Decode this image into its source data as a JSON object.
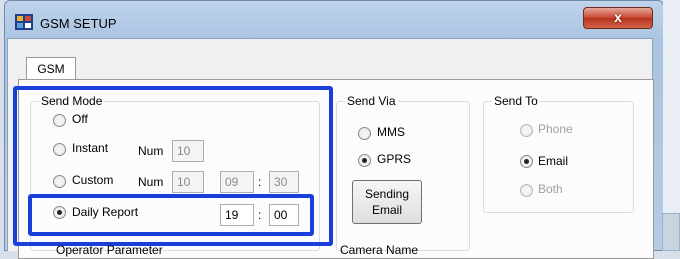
{
  "window": {
    "title": "GSM SETUP",
    "close_symbol": "x"
  },
  "tabs": [
    {
      "label": "GSM"
    }
  ],
  "send_mode": {
    "label": "Send Mode",
    "options": [
      {
        "label": "Off",
        "selected": false
      },
      {
        "label": "Instant",
        "selected": false
      },
      {
        "label": "Custom",
        "selected": false
      },
      {
        "label": "Daily Report",
        "selected": true
      }
    ],
    "instant_num_label": "Num",
    "instant_num_value": "10",
    "custom_num_label": "Num",
    "custom_num_value": "10",
    "custom_hour": "09",
    "custom_minute": "30",
    "daily_hour": "19",
    "daily_minute": "00",
    "time_separator": ":"
  },
  "send_via": {
    "label": "Send Via",
    "options": [
      {
        "label": "MMS",
        "selected": false
      },
      {
        "label": "GPRS",
        "selected": true
      }
    ],
    "button_line1": "Sending",
    "button_line2": "Email"
  },
  "send_to": {
    "label": "Send To",
    "options": [
      {
        "label": "Phone",
        "selected": false,
        "disabled": true
      },
      {
        "label": "Email",
        "selected": true,
        "disabled": false
      },
      {
        "label": "Both",
        "selected": false,
        "disabled": true
      }
    ]
  },
  "bottom_labels": {
    "left": "Operator Parameter",
    "right": "Camera Name"
  },
  "colors": {
    "highlight": "#1a3ed8",
    "title_bar": "#a9c4e2",
    "close_button": "#c9442e"
  }
}
